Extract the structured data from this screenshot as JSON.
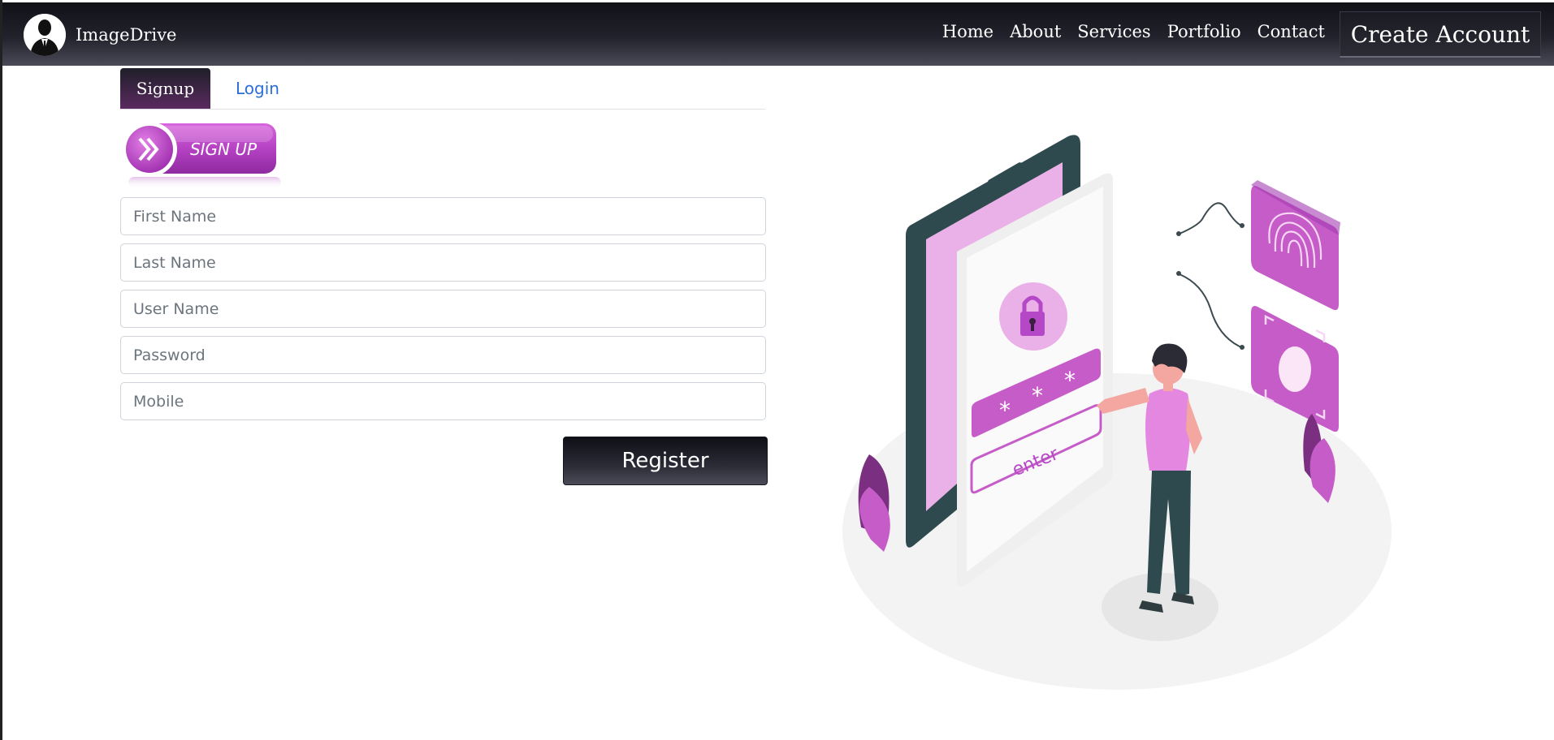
{
  "brand": {
    "name": "ImageDrive",
    "avatar_icon": "person-silhouette-icon"
  },
  "nav": {
    "links": [
      "Home",
      "About",
      "Services",
      "Portfolio",
      "Contact"
    ],
    "create_account": "Create Account"
  },
  "tabs": {
    "signup": "Signup",
    "login": "Login",
    "active": "Signup"
  },
  "badge": {
    "text": "SIGN UP",
    "icon": "double-chevron-right-icon"
  },
  "form": {
    "first_name": {
      "placeholder": "First Name",
      "value": ""
    },
    "last_name": {
      "placeholder": "Last Name",
      "value": ""
    },
    "user_name": {
      "placeholder": "User Name",
      "value": ""
    },
    "password": {
      "placeholder": "Password",
      "value": ""
    },
    "mobile": {
      "placeholder": "Mobile",
      "value": ""
    },
    "register_label": "Register"
  },
  "illustration": {
    "screen_text": "enter"
  },
  "colors": {
    "accent_purple": "#b548c6",
    "light_purple": "#e9b3ea",
    "navbar_dark": "#1c1c24",
    "link_blue": "#2b6fd6"
  }
}
